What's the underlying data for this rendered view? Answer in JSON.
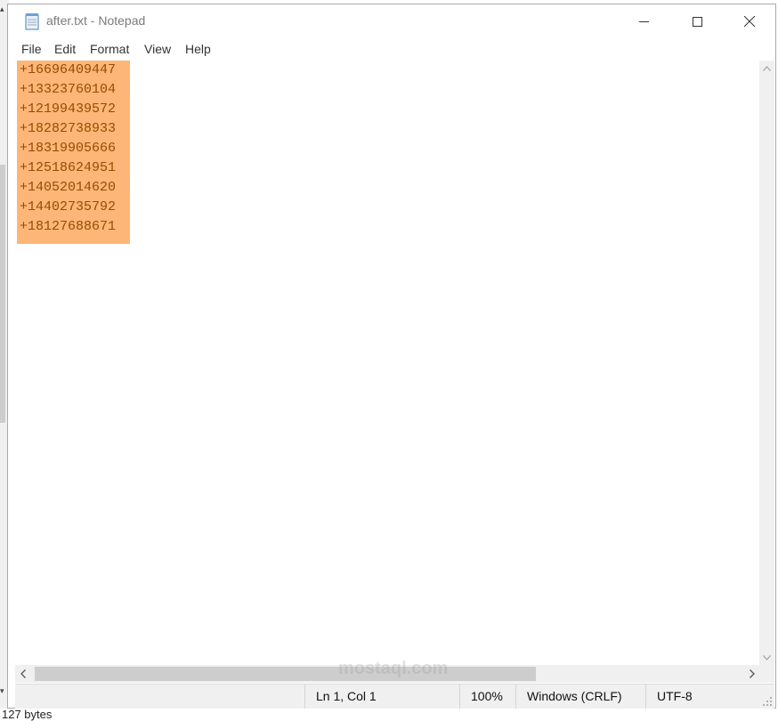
{
  "window": {
    "title": "after.txt - Notepad"
  },
  "menu": [
    "File",
    "Edit",
    "Format",
    "View",
    "Help"
  ],
  "editor": {
    "lines": [
      "+16696409447",
      "+13323760104",
      "+12199439572",
      "+18282738933",
      "+18319905666",
      "+12518624951",
      "+14052014620",
      "+14402735792",
      "+18127688671"
    ],
    "selection_bg": "#fdb677",
    "selection_text": "#964c02"
  },
  "status": {
    "position": "Ln 1, Col 1",
    "zoom": "100%",
    "line_ending": "Windows (CRLF)",
    "encoding": "UTF-8"
  },
  "background": {
    "explorer_status": "127 bytes"
  },
  "watermark": "mostaql.com",
  "icons": [
    "notepad-icon",
    "minimize-icon",
    "maximize-icon",
    "close-icon",
    "scroll-up-icon",
    "scroll-down-icon",
    "scroll-left-icon",
    "scroll-right-icon",
    "resize-grip-icon"
  ]
}
